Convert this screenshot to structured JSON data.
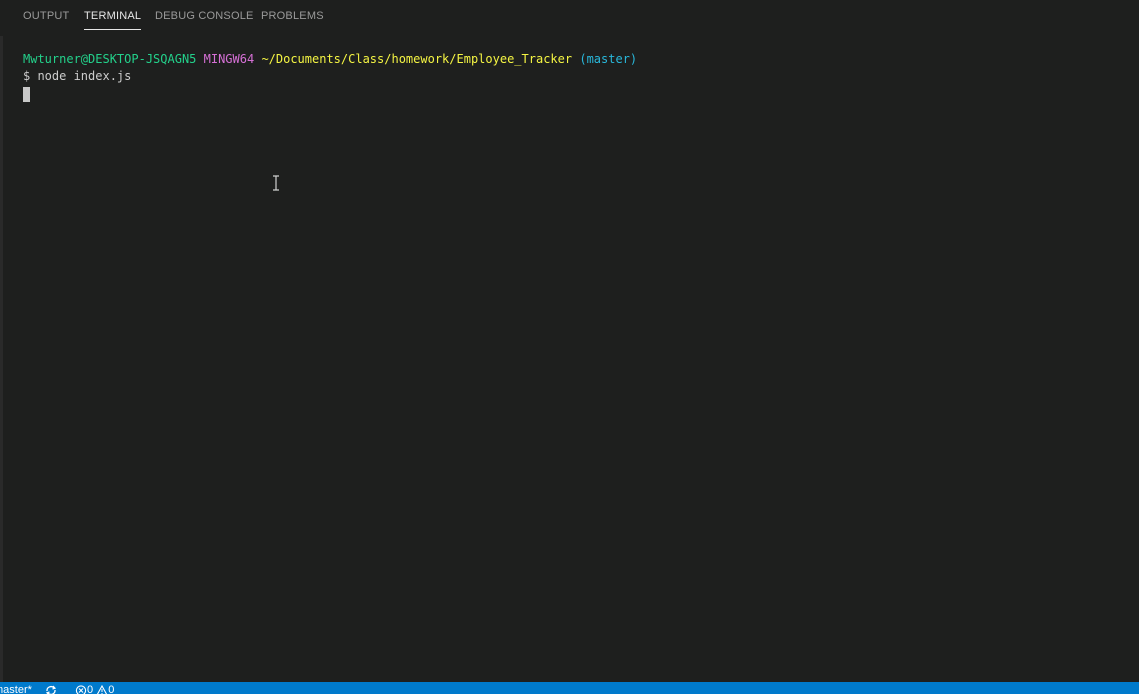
{
  "panel": {
    "tabs": [
      {
        "label": "OUTPUT",
        "active": false
      },
      {
        "label": "TERMINAL",
        "active": true
      },
      {
        "label": "DEBUG CONSOLE",
        "active": false
      },
      {
        "label": "PROBLEMS",
        "active": false
      }
    ]
  },
  "terminal": {
    "prompt": {
      "user_host": "Mwturner@DESKTOP-JSQAGN5",
      "system": "MINGW64",
      "path": "~/Documents/Class/homework/Employee_Tracker",
      "branch": "(master)"
    },
    "command": "$ node index.js"
  },
  "status_bar": {
    "branch": "master*",
    "errors": "0",
    "warnings": "0",
    "background": "#007acc"
  },
  "colors": {
    "user_host": "#23d18b",
    "system": "#d670d6",
    "path": "#f5f543",
    "branch": "#29b8db"
  }
}
